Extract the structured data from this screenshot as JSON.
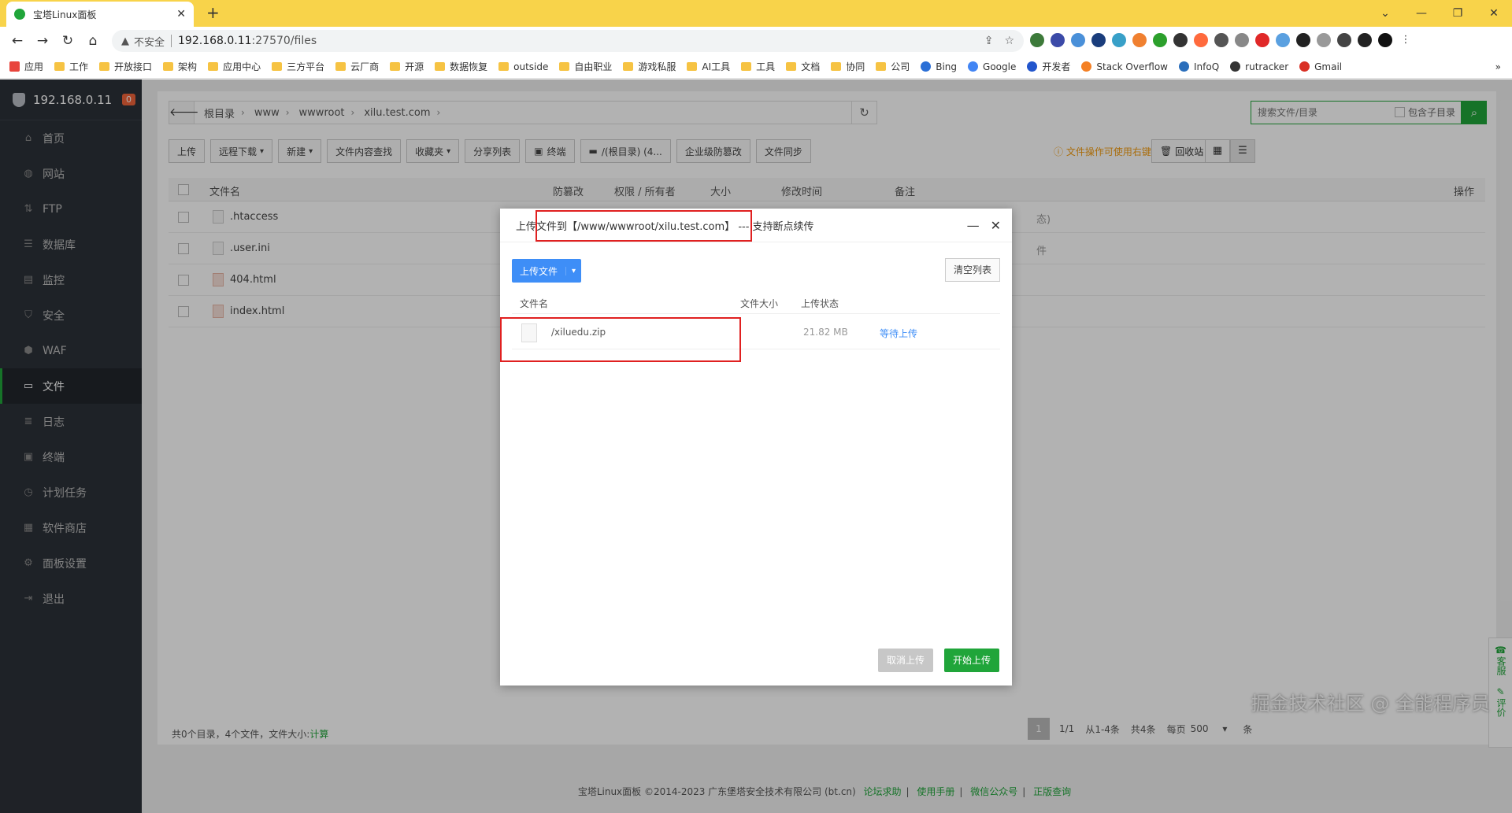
{
  "browser": {
    "tab_title": "宝塔Linux面板",
    "insecure_label": "不安全",
    "url_host": "192.168.0.11",
    "url_rest": ":27570/files",
    "bookmarks": [
      "应用",
      "工作",
      "开放接口",
      "架构",
      "应用中心",
      "三方平台",
      "云厂商",
      "开源",
      "数据恢复",
      "outside",
      "自由职业",
      "游戏私服",
      "AI工具",
      "工具",
      "文档",
      "协同",
      "公司",
      "Bing",
      "Google",
      "开发者",
      "Stack Overflow",
      "InfoQ",
      "rutracker",
      "Gmail"
    ]
  },
  "sidebar": {
    "host": "192.168.0.11",
    "badge": "0",
    "items": [
      {
        "label": "首页",
        "icon": "home-icon"
      },
      {
        "label": "网站",
        "icon": "globe-icon"
      },
      {
        "label": "FTP",
        "icon": "ftp-icon"
      },
      {
        "label": "数据库",
        "icon": "database-icon"
      },
      {
        "label": "监控",
        "icon": "monitor-icon"
      },
      {
        "label": "安全",
        "icon": "shield-icon"
      },
      {
        "label": "WAF",
        "icon": "waf-icon"
      },
      {
        "label": "文件",
        "icon": "folder-icon"
      },
      {
        "label": "日志",
        "icon": "log-icon"
      },
      {
        "label": "终端",
        "icon": "terminal-icon"
      },
      {
        "label": "计划任务",
        "icon": "clock-icon"
      },
      {
        "label": "软件商店",
        "icon": "apps-icon"
      },
      {
        "label": "面板设置",
        "icon": "settings-icon"
      },
      {
        "label": "退出",
        "icon": "logout-icon"
      }
    ]
  },
  "path": {
    "crumbs": [
      "根目录",
      "www",
      "wwwroot",
      "xilu.test.com"
    ]
  },
  "search": {
    "placeholder": "搜索文件/目录",
    "subdir_label": "包含子目录"
  },
  "toolbar": {
    "upload": "上传",
    "remote_download": "远程下载",
    "new": "新建",
    "content_search": "文件内容查找",
    "favorites": "收藏夹",
    "share_list": "分享列表",
    "terminal": "终端",
    "disk": "/(根目录) (4...",
    "tamper": "企业级防篡改",
    "sync": "文件同步",
    "tip": "文件操作可使用右键",
    "recycle": "回收站"
  },
  "table": {
    "headers": {
      "name": "文件名",
      "tamper": "防篡改",
      "perm": "权限 / 所有者",
      "size": "大小",
      "mtime": "修改时间",
      "note": "备注",
      "ops": "操作"
    },
    "rows": [
      {
        "name": ".htaccess",
        "type": "file",
        "extra": "态)"
      },
      {
        "name": ".user.ini",
        "type": "file",
        "extra": "件"
      },
      {
        "name": "404.html",
        "type": "html",
        "extra": ""
      },
      {
        "name": "index.html",
        "type": "html",
        "extra": ""
      }
    ]
  },
  "summary": {
    "text": "共0个目录，4个文件，文件大小:",
    "calc": "计算"
  },
  "pager": {
    "current": "1",
    "pages": "1/1",
    "range": "从1-4条",
    "total": "共4条",
    "per_page_label": "每页",
    "per_page": "500",
    "unit": "条"
  },
  "footer": {
    "copyright": "宝塔Linux面板 ©2014-2023 广东堡塔安全技术有限公司 (bt.cn)",
    "links": [
      "论坛求助",
      "使用手册",
      "微信公众号",
      "正版查询"
    ]
  },
  "watermark": "掘金技术社区 @ 全能程序员",
  "widget": {
    "service": "客服",
    "review": "评价"
  },
  "modal": {
    "title_prefix": "上传",
    "title_path": "文件到【/www/wwwroot/xilu.test.com】",
    "title_suffix": "--- 支持断点续传",
    "upload_btn": "上传文件",
    "clear_btn": "清空列表",
    "headers": {
      "name": "文件名",
      "size": "文件大小",
      "status": "上传状态"
    },
    "file": {
      "name": "/xiluedu.zip",
      "size": "21.82 MB",
      "status": "等待上传"
    },
    "cancel_btn": "取消上传",
    "start_btn": "开始上传"
  }
}
